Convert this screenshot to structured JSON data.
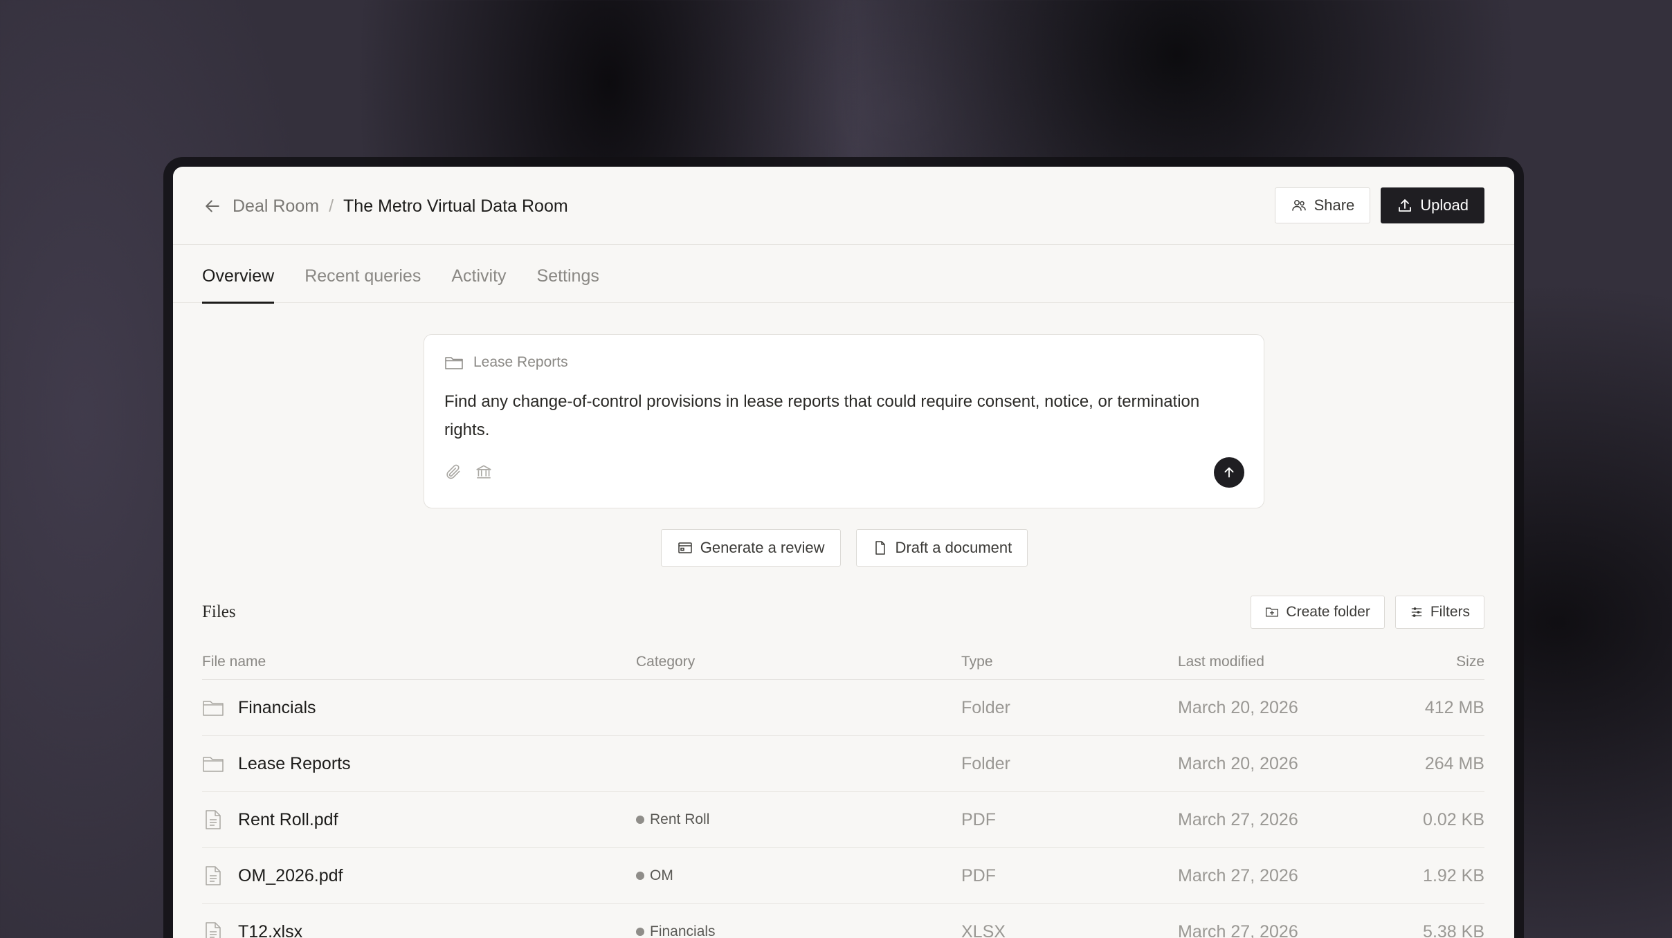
{
  "header": {
    "breadcrumb_parent": "Deal Room",
    "breadcrumb_separator": "/",
    "breadcrumb_current": "The Metro Virtual Data Room",
    "share_label": "Share",
    "upload_label": "Upload"
  },
  "tabs": [
    {
      "label": "Overview",
      "active": true
    },
    {
      "label": "Recent queries",
      "active": false
    },
    {
      "label": "Activity",
      "active": false
    },
    {
      "label": "Settings",
      "active": false
    }
  ],
  "composer": {
    "context_label": "Lease Reports",
    "prompt_text": "Find any change-of-control provisions in lease reports that could require consent, notice, or termination rights."
  },
  "quick_actions": {
    "generate_review": "Generate a review",
    "draft_document": "Draft a document"
  },
  "files": {
    "title": "Files",
    "create_folder_label": "Create folder",
    "filters_label": "Filters",
    "columns": {
      "name": "File name",
      "category": "Category",
      "type": "Type",
      "modified": "Last modified",
      "size": "Size"
    },
    "rows": [
      {
        "name": "Financials",
        "category": "",
        "type": "Folder",
        "modified": "March 20, 2026",
        "size": "412 MB",
        "icon": "folder-icon"
      },
      {
        "name": "Lease Reports",
        "category": "",
        "type": "Folder",
        "modified": "March 20, 2026",
        "size": "264 MB",
        "icon": "folder-icon"
      },
      {
        "name": "Rent Roll.pdf",
        "category": "Rent Roll",
        "type": "PDF",
        "modified": "March 27, 2026",
        "size": "0.02 KB",
        "icon": "file-icon"
      },
      {
        "name": "OM_2026.pdf",
        "category": "OM",
        "type": "PDF",
        "modified": "March 27, 2026",
        "size": "1.92 KB",
        "icon": "file-icon"
      },
      {
        "name": "T12.xlsx",
        "category": "Financials",
        "type": "XLSX",
        "modified": "March 27, 2026",
        "size": "5.38 KB",
        "icon": "file-icon"
      }
    ]
  },
  "colors": {
    "accent_dark": "#1f1e22",
    "surface": "#f8f7f5",
    "background": "#34303c"
  }
}
